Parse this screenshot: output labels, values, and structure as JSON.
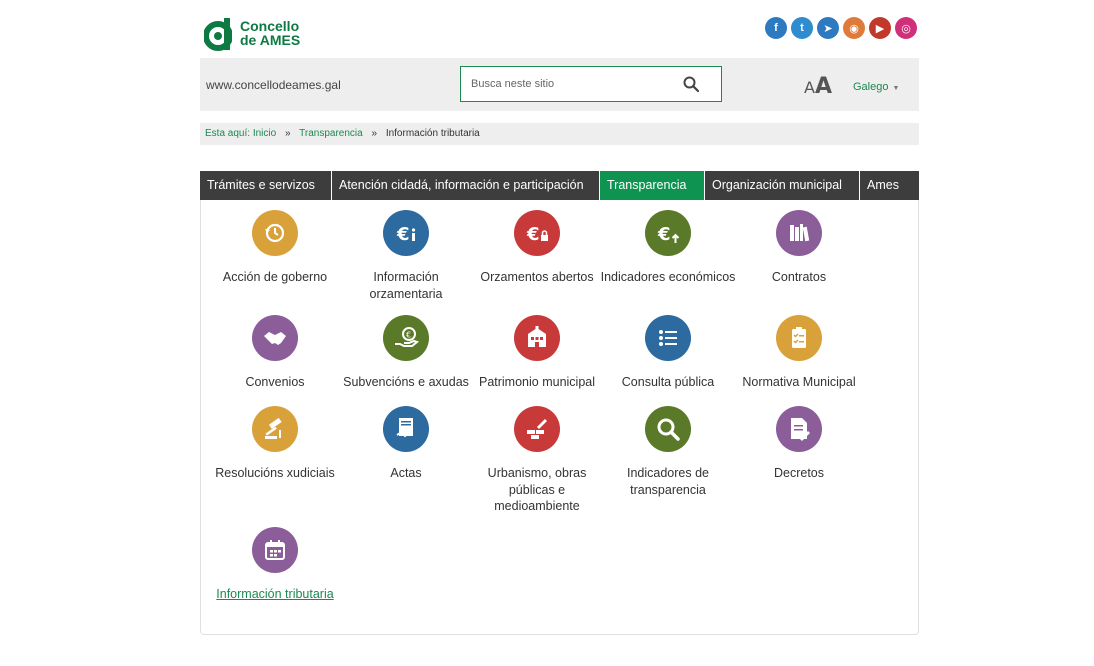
{
  "header": {
    "logo_line1": "Concello",
    "logo_line2": "de AMES",
    "social": [
      {
        "icon": "facebook-icon",
        "glyph": "f",
        "color": "#2e7ac0"
      },
      {
        "icon": "twitter-icon",
        "glyph": "t",
        "color": "#2e8ccf"
      },
      {
        "icon": "telegram-icon",
        "glyph": "➤",
        "color": "#2e7ac0"
      },
      {
        "icon": "rss-icon",
        "glyph": "◉",
        "color": "#e07a3a"
      },
      {
        "icon": "youtube-icon",
        "glyph": "▶",
        "color": "#c0392b"
      },
      {
        "icon": "instagram-icon",
        "glyph": "◎",
        "color": "#d0307a"
      }
    ]
  },
  "topbar": {
    "site_url": "www.concellodeames.gal",
    "search_placeholder": "Busca neste sitio",
    "font_small": "A",
    "font_large": "A",
    "language": "Galego"
  },
  "breadcrumb": {
    "prefix": "Esta aquí:",
    "home": "Inicio",
    "section": "Transparencia",
    "current": "Información tributaria",
    "separator": "»"
  },
  "nav": {
    "tabs": [
      {
        "label": "Trámites e servizos",
        "active": false
      },
      {
        "label": "Atención cidadá, información e participación",
        "active": false
      },
      {
        "label": "Transparencia",
        "active": true
      },
      {
        "label": "Organización municipal",
        "active": false
      },
      {
        "label": "Ames",
        "active": false
      }
    ]
  },
  "items": [
    {
      "label": "Acción de goberno",
      "icon": "history-icon",
      "color": "#d9a13a"
    },
    {
      "label": "Información orzamentaria",
      "icon": "euro-info-icon",
      "color": "#2d6aa0"
    },
    {
      "label": "Orzamentos abertos",
      "icon": "euro-lock-icon",
      "color": "#c83a3a"
    },
    {
      "label": "Indicadores económicos",
      "icon": "euro-up-icon",
      "color": "#5a7a2a"
    },
    {
      "label": "Contratos",
      "icon": "books-icon",
      "color": "#8b5e9a"
    },
    {
      "label": "Convenios",
      "icon": "handshake-icon",
      "color": "#8b5e9a"
    },
    {
      "label": "Subvencións e axudas",
      "icon": "hand-coin-icon",
      "color": "#5a7a2a"
    },
    {
      "label": "Patrimonio municipal",
      "icon": "building-icon",
      "color": "#c83a3a"
    },
    {
      "label": "Consulta pública",
      "icon": "list-icon",
      "color": "#2d6aa0"
    },
    {
      "label": "Normativa Municipal",
      "icon": "clipboard-icon",
      "color": "#d9a13a"
    },
    {
      "label": "Resolucións xudiciais",
      "icon": "gavel-icon",
      "color": "#d9a13a"
    },
    {
      "label": "Actas",
      "icon": "document-signed-icon",
      "color": "#2d6aa0"
    },
    {
      "label": "Urbanismo, obras públicas e medioambiente",
      "icon": "trowel-wall-icon",
      "color": "#c83a3a"
    },
    {
      "label": "Indicadores de transparencia",
      "icon": "magnifier-icon",
      "color": "#5a7a2a"
    },
    {
      "label": "Decretos",
      "icon": "document-edit-icon",
      "color": "#8b5e9a"
    },
    {
      "label": "Información tributaria",
      "icon": "calendar-icon",
      "color": "#8b5e9a",
      "link": true
    }
  ]
}
